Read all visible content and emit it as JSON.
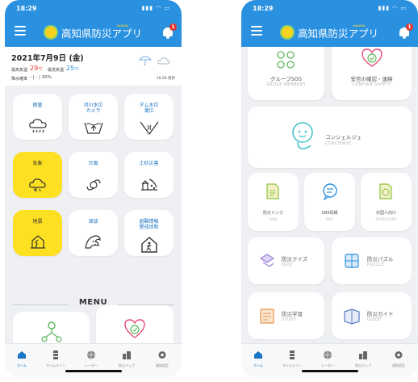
{
  "status": {
    "time": "18:29"
  },
  "header": {
    "title": "高知県防災アプリ",
    "notification_count": "1"
  },
  "weather": {
    "date": "2021年7月9日 (金)",
    "max_label": "最高気温",
    "max_value": "29",
    "min_label": "最低気温",
    "min_value": "25",
    "unit": "℃",
    "rain_label": "降水確率",
    "rain_values": "- | - | 30%",
    "updated": "18:28 更新",
    "colors": {
      "max": "#e5352c",
      "min": "#2a91e0"
    }
  },
  "tiles": [
    {
      "label": "雨量",
      "icon": "rain-cloud-icon"
    },
    {
      "label": "河川水位\nカメラ",
      "icon": "river-camera-icon"
    },
    {
      "label": "ダム水位\n潮位",
      "icon": "dam-icon"
    },
    {
      "label": "気象",
      "icon": "weather-icon",
      "highlight": true
    },
    {
      "label": "台風",
      "icon": "typhoon-icon"
    },
    {
      "label": "土砂災害",
      "icon": "landslide-icon"
    },
    {
      "label": "地震",
      "icon": "earthquake-icon",
      "highlight": true
    },
    {
      "label": "津波",
      "icon": "tsunami-icon"
    },
    {
      "label": "避難情報\n警戒体制",
      "icon": "evacuation-icon"
    }
  ],
  "menu": {
    "heading": "MENU"
  },
  "right_menu": {
    "group": {
      "label": "グループSOS",
      "sub": "GROUP MEMBERS"
    },
    "confirm": {
      "label": "安否の確認・連絡",
      "sub": "CONFIRM SAFETY"
    },
    "concierge": {
      "label": "コンシェルジュ",
      "sub": "CONCIERGE"
    },
    "link": {
      "label": "防災リンク",
      "sub": "LINK"
    },
    "sns": {
      "label": "SNS情報",
      "sub": "SNS"
    },
    "foreigner": {
      "label": "外国人向け",
      "sub": "FOREIGNER"
    },
    "quiz": {
      "label": "防災クイズ",
      "sub": "QUIZ"
    },
    "puzzle": {
      "label": "防災パズル",
      "sub": "PUZZLE"
    },
    "study": {
      "label": "防災学習",
      "sub": "STUDY"
    },
    "guide": {
      "label": "防災ガイド",
      "sub": "GUIDE"
    }
  },
  "tabbar": [
    {
      "label": "ホーム",
      "icon": "home-icon"
    },
    {
      "label": "タイムライン",
      "icon": "timeline-icon"
    },
    {
      "label": "レーダー",
      "icon": "radar-icon"
    },
    {
      "label": "防災マップ",
      "icon": "map-icon"
    },
    {
      "label": "通知設定",
      "icon": "settings-icon"
    }
  ],
  "colors": {
    "accent": "#2a91e0",
    "highlight": "#fde021",
    "menu_green": "#5cb85c",
    "menu_pink": "#e84d7a",
    "active_tab": "#1b74c3"
  }
}
